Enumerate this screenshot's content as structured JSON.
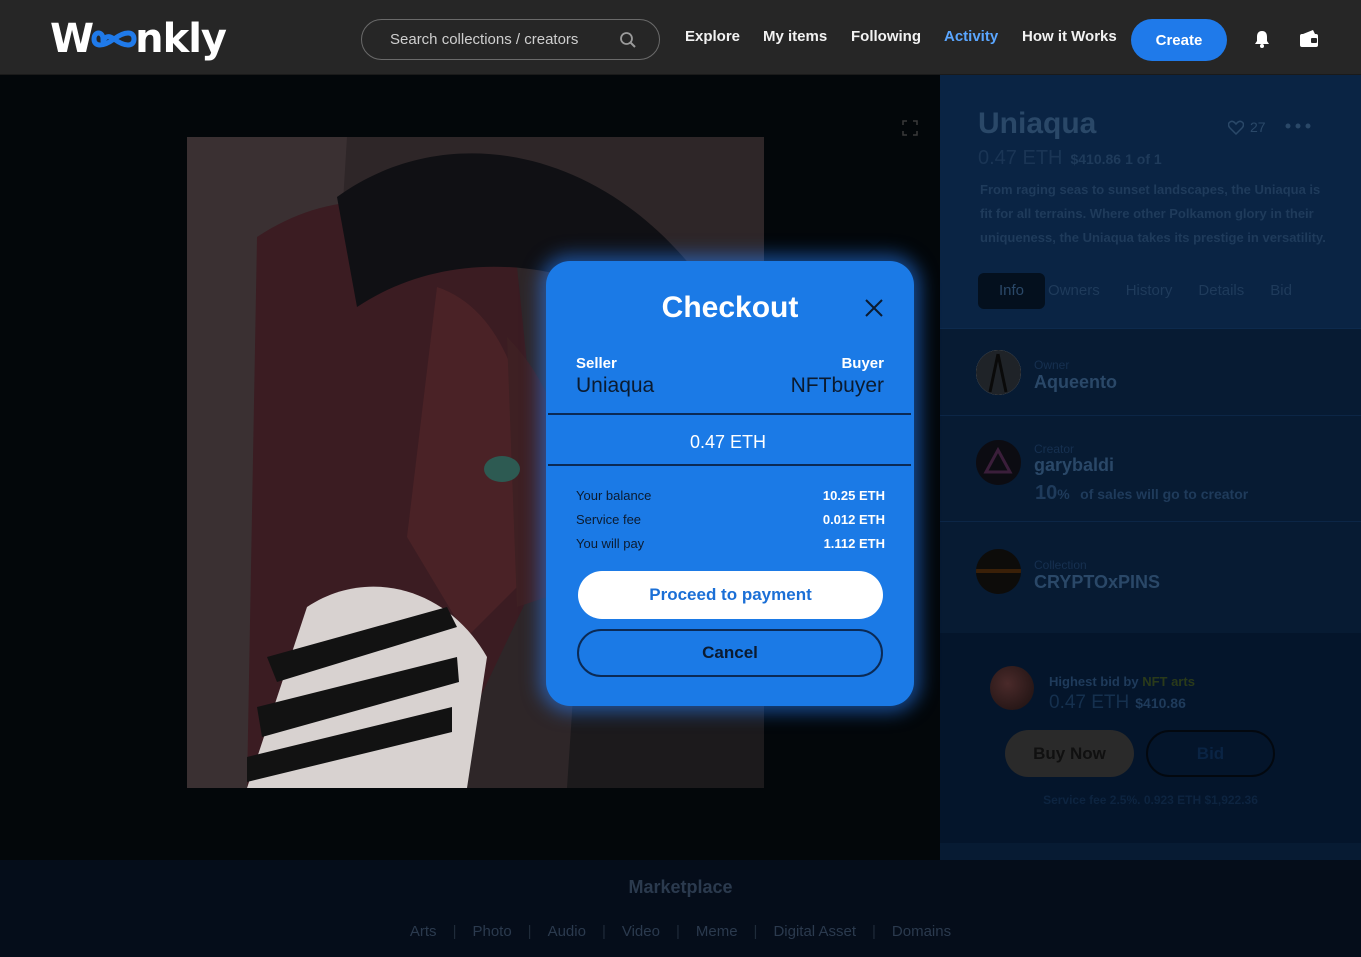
{
  "header": {
    "logo": "Woonkly",
    "search_placeholder": "Search collections / creators",
    "nav": [
      "Explore",
      "My items",
      "Following",
      "Activity",
      "How it Works"
    ],
    "active_nav": "Activity",
    "create_label": "Create",
    "icons": [
      "search-icon",
      "bell-icon",
      "wallet-icon"
    ]
  },
  "item": {
    "title": "Uniaqua",
    "likes": "27",
    "price_eth": "0.47 ETH",
    "price_usd": "$410.86",
    "edition": "1 of 1",
    "description": "From raging seas to sunset landscapes, the Uniaqua is fit for all terrains. Where other Polkamon glory in their uniqueness, the Uniaqua takes its prestige in versatility.",
    "tabs": [
      "Info",
      "Owners",
      "History",
      "Details",
      "Bid"
    ],
    "active_tab": "Info"
  },
  "owner": {
    "role": "Owner",
    "name": "Aqueento"
  },
  "creator": {
    "role": "Creator",
    "name": "garybaldi",
    "royalty_value": "10",
    "royalty_unit": "%",
    "royalty_text": "of sales will go to creator"
  },
  "collection": {
    "role": "Collection",
    "name": "CRYPTOxPINS"
  },
  "bid": {
    "label": "Highest bid by",
    "bidder": "NFT arts",
    "price_eth": "0.47 ETH",
    "price_usd": "$410.86",
    "buy_label": "Buy Now",
    "bid_label": "Bid",
    "service_fee": "Service fee 2.5%. 0.923 ETH  $1,922.36"
  },
  "footer": {
    "title": "Marketplace",
    "links": [
      "Arts",
      "Photo",
      "Audio",
      "Video",
      "Meme",
      "Digital Asset",
      "Domains"
    ]
  },
  "checkout": {
    "title": "Checkout",
    "seller_label": "Seller",
    "seller": "Uniaqua",
    "buyer_label": "Buyer",
    "buyer": "NFTbuyer",
    "amount": "0.47 ETH",
    "rows": [
      {
        "label": "Your balance",
        "value": "10.25 ETH"
      },
      {
        "label": "Service fee",
        "value": "0.012 ETH"
      },
      {
        "label": "You will pay",
        "value": "1.112 ETH"
      }
    ],
    "proceed_label": "Proceed to payment",
    "cancel_label": "Cancel"
  },
  "colors": {
    "accent": "#1f7aea",
    "modal": "#1b7ae6",
    "active_nav": "#5aa6ff",
    "header": "#262626"
  }
}
